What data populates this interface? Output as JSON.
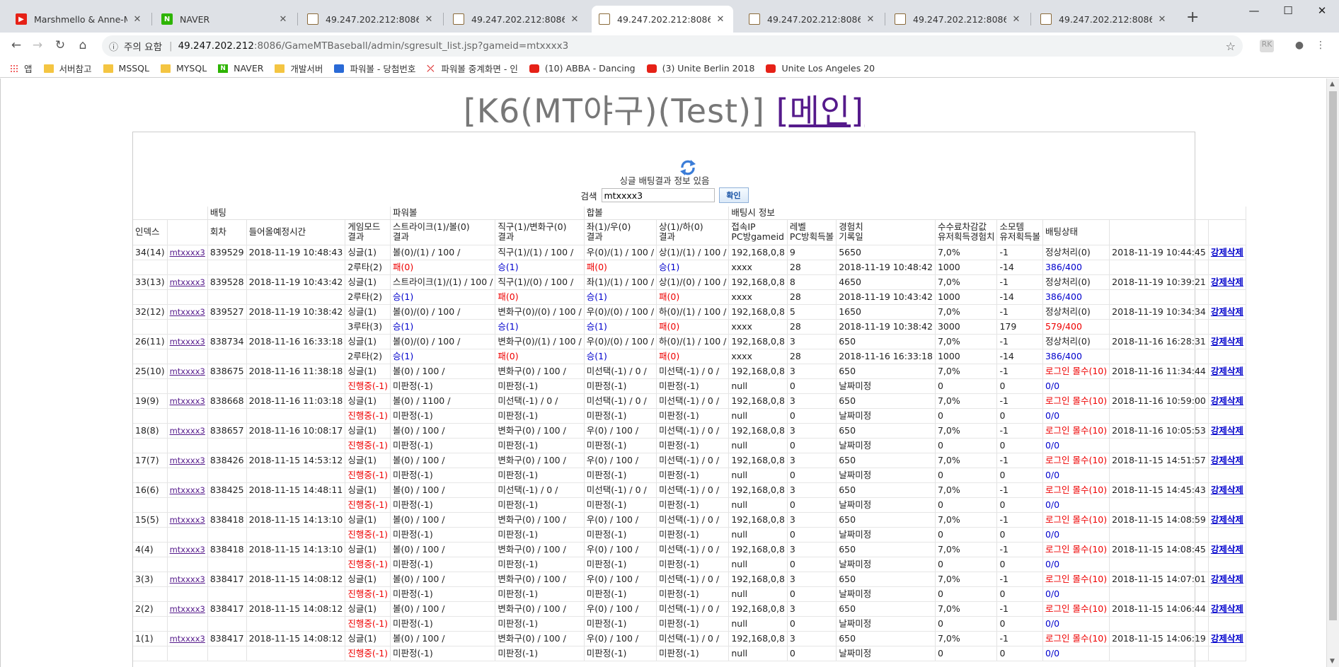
{
  "browser": {
    "tabs": [
      {
        "title": "Marshmello & Anne-Marie",
        "favicon": "youtube-icon"
      },
      {
        "title": "NAVER",
        "favicon": "naver-icon"
      },
      {
        "title": "49.247.202.212:8086/Game",
        "favicon": "page-icon"
      },
      {
        "title": "49.247.202.212:8086/Game",
        "favicon": "page-icon"
      },
      {
        "title": "49.247.202.212:8086/Gam",
        "favicon": "page-icon",
        "active": true
      },
      {
        "title": "49.247.202.212:8086/Game",
        "favicon": "page-icon"
      },
      {
        "title": "49.247.202.212:8086/Game",
        "favicon": "page-icon"
      },
      {
        "title": "49.247.202.212:8086/Game",
        "favicon": "page-icon"
      }
    ],
    "security_warning": "주의 요함",
    "url_host": "49.247.202.212",
    "url_path": ":8086/GameMTBaseball/admin/sgresult_list.jsp?gameid=mtxxxx3",
    "bookmarks": [
      {
        "label": "앱",
        "icon": "apps-grid-icon"
      },
      {
        "label": "서버참고",
        "icon": "folder-icon"
      },
      {
        "label": "MSSQL",
        "icon": "folder-icon"
      },
      {
        "label": "MYSQL",
        "icon": "folder-icon"
      },
      {
        "label": "NAVER",
        "icon": "naver-icon"
      },
      {
        "label": "개발서버",
        "icon": "folder-icon"
      },
      {
        "label": "파워볼 - 당첨번호",
        "icon": "powerball-icon"
      },
      {
        "label": "파워볼 중계화면 - 인",
        "icon": "powerball-relay-icon"
      },
      {
        "label": "(10) ABBA - Dancing",
        "icon": "youtube-icon"
      },
      {
        "label": "(3) Unite Berlin 2018",
        "icon": "youtube-icon"
      },
      {
        "label": "Unite Los Angeles 20",
        "icon": "youtube-icon"
      }
    ]
  },
  "page": {
    "title": "[K6(MT야구)(Test)]",
    "main_link": "[메인]",
    "info_text": "싱글 배팅결과 정보 있음",
    "search_label": "검색",
    "search_value": "mtxxxx3",
    "search_button": "확인"
  },
  "table": {
    "group_headers": [
      "배팅",
      "파워볼",
      "합볼",
      "배팅시 정보"
    ],
    "headers": [
      [
        "인덱스",
        ""
      ],
      [
        "",
        ""
      ],
      [
        "회차",
        ""
      ],
      [
        "들어올예정시간",
        ""
      ],
      [
        "게임모드",
        "결과"
      ],
      [
        "스트라이크(1)/볼(0)",
        "결과"
      ],
      [
        "직구(1)/변화구(0)",
        "결과"
      ],
      [
        "좌(1)/우(0)",
        "결과"
      ],
      [
        "상(1)/하(0)",
        "결과"
      ],
      [
        "접속IP",
        "PC방gameid"
      ],
      [
        "레벨",
        "PC방획득볼"
      ],
      [
        "경험치",
        "기록일"
      ],
      [
        "수수료차감값",
        "유저획득경험치"
      ],
      [
        "소모템",
        "유저획득볼"
      ],
      [
        "배팅상태",
        ""
      ],
      [
        "",
        ""
      ],
      [
        "",
        ""
      ]
    ],
    "rows": [
      {
        "idx": "34(14)",
        "user": "mtxxxx3",
        "round": "839529",
        "time": "2018-11-19 10:48:43",
        "mode": "싱글(1)",
        "c5": "볼(0)/(1) / 100 /",
        "c6": "직구(1)/(1) / 100 /",
        "c7": "우(0)/(1) / 100 /",
        "c8": "상(1)/(1) / 100 /",
        "ip": "192,168,0,8",
        "lv": "9",
        "exp": "5650",
        "fee": "7,0%",
        "item": "-1",
        "status": "정상처리(0)",
        "status_red": false,
        "date": "2018-11-19 10:44:45",
        "del": "강제삭제",
        "r_mode": "2루타(2)",
        "r_mode_red": false,
        "r5": "패(0)",
        "r5c": "red",
        "r6": "승(1)",
        "r6c": "blue",
        "r7": "패(0)",
        "r7c": "red",
        "r8": "승(1)",
        "r8c": "blue",
        "r_ip": "xxxx",
        "r_lv": "28",
        "r_exp": "2018-11-19 10:48:42",
        "r_fee": "1000",
        "r_item": "-14",
        "r_status": "386/400",
        "r_status_red": false
      },
      {
        "idx": "33(13)",
        "user": "mtxxxx3",
        "round": "839528",
        "time": "2018-11-19 10:43:42",
        "mode": "싱글(1)",
        "c5": "스트라이크(1)/(1) / 100 /",
        "c6": "직구(1)/(0) / 100 /",
        "c7": "좌(1)/(1) / 100 /",
        "c8": "상(1)/(0) / 100 /",
        "ip": "192,168,0,8",
        "lv": "8",
        "exp": "4650",
        "fee": "7,0%",
        "item": "-1",
        "status": "정상처리(0)",
        "status_red": false,
        "date": "2018-11-19 10:39:21",
        "del": "강제삭제",
        "r_mode": "2루타(2)",
        "r_mode_red": false,
        "r5": "승(1)",
        "r5c": "blue",
        "r6": "패(0)",
        "r6c": "red",
        "r7": "승(1)",
        "r7c": "blue",
        "r8": "패(0)",
        "r8c": "red",
        "r_ip": "xxxx",
        "r_lv": "28",
        "r_exp": "2018-11-19 10:43:42",
        "r_fee": "1000",
        "r_item": "-14",
        "r_status": "386/400",
        "r_status_red": false
      },
      {
        "idx": "32(12)",
        "user": "mtxxxx3",
        "round": "839527",
        "time": "2018-11-19 10:38:42",
        "mode": "싱글(1)",
        "c5": "볼(0)/(0) / 100 /",
        "c6": "변화구(0)/(0) / 100 /",
        "c7": "우(0)/(0) / 100 /",
        "c8": "하(0)/(1) / 100 /",
        "ip": "192,168,0,8",
        "lv": "5",
        "exp": "1650",
        "fee": "7,0%",
        "item": "-1",
        "status": "정상처리(0)",
        "status_red": false,
        "date": "2018-11-19 10:34:34",
        "del": "강제삭제",
        "r_mode": "3루타(3)",
        "r_mode_red": false,
        "r5": "승(1)",
        "r5c": "blue",
        "r6": "승(1)",
        "r6c": "blue",
        "r7": "승(1)",
        "r7c": "blue",
        "r8": "패(0)",
        "r8c": "red",
        "r_ip": "xxxx",
        "r_lv": "28",
        "r_exp": "2018-11-19 10:38:42",
        "r_fee": "3000",
        "r_item": "179",
        "r_status": "579/400",
        "r_status_red": true
      },
      {
        "idx": "26(11)",
        "user": "mtxxxx3",
        "round": "838734",
        "time": "2018-11-16 16:33:18",
        "mode": "싱글(1)",
        "c5": "볼(0)/(0) / 100 /",
        "c6": "변화구(0)/(1) / 100 /",
        "c7": "우(0)/(0) / 100 /",
        "c8": "하(0)/(1) / 100 /",
        "ip": "192,168,0,8",
        "lv": "3",
        "exp": "650",
        "fee": "7,0%",
        "item": "-1",
        "status": "정상처리(0)",
        "status_red": false,
        "date": "2018-11-16 16:28:31",
        "del": "강제삭제",
        "r_mode": "2루타(2)",
        "r_mode_red": false,
        "r5": "승(1)",
        "r5c": "blue",
        "r6": "패(0)",
        "r6c": "red",
        "r7": "승(1)",
        "r7c": "blue",
        "r8": "패(0)",
        "r8c": "red",
        "r_ip": "xxxx",
        "r_lv": "28",
        "r_exp": "2018-11-16 16:33:18",
        "r_fee": "1000",
        "r_item": "-14",
        "r_status": "386/400",
        "r_status_red": false
      },
      {
        "idx": "25(10)",
        "user": "mtxxxx3",
        "round": "838675",
        "time": "2018-11-16 11:38:18",
        "mode": "싱글(1)",
        "c5": "볼(0) / 100 /",
        "c6": "변화구(0) / 100 /",
        "c7": "미선택(-1) / 0 /",
        "c8": "미선택(-1) / 0 /",
        "ip": "192,168,0,8",
        "lv": "3",
        "exp": "650",
        "fee": "7,0%",
        "item": "-1",
        "status": "로그인 몰수(10)",
        "status_red": true,
        "date": "2018-11-16 11:34:44",
        "del": "강제삭제",
        "r_mode": "진행중(-1)",
        "r_mode_red": true,
        "r5": "미판정(-1)",
        "r5c": "",
        "r6": "미판정(-1)",
        "r6c": "",
        "r7": "미판정(-1)",
        "r7c": "",
        "r8": "미판정(-1)",
        "r8c": "",
        "r_ip": "null",
        "r_lv": "0",
        "r_exp": "날짜미정",
        "r_fee": "0",
        "r_item": "0",
        "r_status": "0/0",
        "r_status_red": false
      },
      {
        "idx": "19(9)",
        "user": "mtxxxx3",
        "round": "838668",
        "time": "2018-11-16 11:03:18",
        "mode": "싱글(1)",
        "c5": "볼(0) / 1100 /",
        "c6": "미선택(-1) / 0 /",
        "c7": "미선택(-1) / 0 /",
        "c8": "미선택(-1) / 0 /",
        "ip": "192,168,0,8",
        "lv": "3",
        "exp": "650",
        "fee": "7,0%",
        "item": "-1",
        "status": "로그인 몰수(10)",
        "status_red": true,
        "date": "2018-11-16 10:59:00",
        "del": "강제삭제",
        "r_mode": "진행중(-1)",
        "r_mode_red": true,
        "r5": "미판정(-1)",
        "r5c": "",
        "r6": "미판정(-1)",
        "r6c": "",
        "r7": "미판정(-1)",
        "r7c": "",
        "r8": "미판정(-1)",
        "r8c": "",
        "r_ip": "null",
        "r_lv": "0",
        "r_exp": "날짜미정",
        "r_fee": "0",
        "r_item": "0",
        "r_status": "0/0",
        "r_status_red": false
      },
      {
        "idx": "18(8)",
        "user": "mtxxxx3",
        "round": "838657",
        "time": "2018-11-16 10:08:17",
        "mode": "싱글(1)",
        "c5": "볼(0) / 100 /",
        "c6": "변화구(0) / 100 /",
        "c7": "우(0) / 100 /",
        "c8": "미선택(-1) / 0 /",
        "ip": "192,168,0,8",
        "lv": "3",
        "exp": "650",
        "fee": "7,0%",
        "item": "-1",
        "status": "로그인 몰수(10)",
        "status_red": true,
        "date": "2018-11-16 10:05:53",
        "del": "강제삭제",
        "r_mode": "진행중(-1)",
        "r_mode_red": true,
        "r5": "미판정(-1)",
        "r5c": "",
        "r6": "미판정(-1)",
        "r6c": "",
        "r7": "미판정(-1)",
        "r7c": "",
        "r8": "미판정(-1)",
        "r8c": "",
        "r_ip": "null",
        "r_lv": "0",
        "r_exp": "날짜미정",
        "r_fee": "0",
        "r_item": "0",
        "r_status": "0/0",
        "r_status_red": false
      },
      {
        "idx": "17(7)",
        "user": "mtxxxx3",
        "round": "838426",
        "time": "2018-11-15 14:53:12",
        "mode": "싱글(1)",
        "c5": "볼(0) / 100 /",
        "c6": "변화구(0) / 100 /",
        "c7": "우(0) / 100 /",
        "c8": "미선택(-1) / 0 /",
        "ip": "192,168,0,8",
        "lv": "3",
        "exp": "650",
        "fee": "7,0%",
        "item": "-1",
        "status": "로그인 몰수(10)",
        "status_red": true,
        "date": "2018-11-15 14:51:57",
        "del": "강제삭제",
        "r_mode": "진행중(-1)",
        "r_mode_red": true,
        "r5": "미판정(-1)",
        "r5c": "",
        "r6": "미판정(-1)",
        "r6c": "",
        "r7": "미판정(-1)",
        "r7c": "",
        "r8": "미판정(-1)",
        "r8c": "",
        "r_ip": "null",
        "r_lv": "0",
        "r_exp": "날짜미정",
        "r_fee": "0",
        "r_item": "0",
        "r_status": "0/0",
        "r_status_red": false
      },
      {
        "idx": "16(6)",
        "user": "mtxxxx3",
        "round": "838425",
        "time": "2018-11-15 14:48:11",
        "mode": "싱글(1)",
        "c5": "볼(0) / 100 /",
        "c6": "미선택(-1) / 0 /",
        "c7": "미선택(-1) / 0 /",
        "c8": "미선택(-1) / 0 /",
        "ip": "192,168,0,8",
        "lv": "3",
        "exp": "650",
        "fee": "7,0%",
        "item": "-1",
        "status": "로그인 몰수(10)",
        "status_red": true,
        "date": "2018-11-15 14:45:43",
        "del": "강제삭제",
        "r_mode": "진행중(-1)",
        "r_mode_red": true,
        "r5": "미판정(-1)",
        "r5c": "",
        "r6": "미판정(-1)",
        "r6c": "",
        "r7": "미판정(-1)",
        "r7c": "",
        "r8": "미판정(-1)",
        "r8c": "",
        "r_ip": "null",
        "r_lv": "0",
        "r_exp": "날짜미정",
        "r_fee": "0",
        "r_item": "0",
        "r_status": "0/0",
        "r_status_red": false
      },
      {
        "idx": "15(5)",
        "user": "mtxxxx3",
        "round": "838418",
        "time": "2018-11-15 14:13:10",
        "mode": "싱글(1)",
        "c5": "볼(0) / 100 /",
        "c6": "변화구(0) / 100 /",
        "c7": "우(0) / 100 /",
        "c8": "미선택(-1) / 0 /",
        "ip": "192,168,0,8",
        "lv": "3",
        "exp": "650",
        "fee": "7,0%",
        "item": "-1",
        "status": "로그인 몰수(10)",
        "status_red": true,
        "date": "2018-11-15 14:08:59",
        "del": "강제삭제",
        "r_mode": "진행중(-1)",
        "r_mode_red": true,
        "r5": "미판정(-1)",
        "r5c": "",
        "r6": "미판정(-1)",
        "r6c": "",
        "r7": "미판정(-1)",
        "r7c": "",
        "r8": "미판정(-1)",
        "r8c": "",
        "r_ip": "null",
        "r_lv": "0",
        "r_exp": "날짜미정",
        "r_fee": "0",
        "r_item": "0",
        "r_status": "0/0",
        "r_status_red": false
      },
      {
        "idx": "4(4)",
        "user": "mtxxxx3",
        "round": "838418",
        "time": "2018-11-15 14:13:10",
        "mode": "싱글(1)",
        "c5": "볼(0) / 100 /",
        "c6": "변화구(0) / 100 /",
        "c7": "우(0) / 100 /",
        "c8": "미선택(-1) / 0 /",
        "ip": "192,168,0,8",
        "lv": "3",
        "exp": "650",
        "fee": "7,0%",
        "item": "-1",
        "status": "로그인 몰수(10)",
        "status_red": true,
        "date": "2018-11-15 14:08:45",
        "del": "강제삭제",
        "r_mode": "진행중(-1)",
        "r_mode_red": true,
        "r5": "미판정(-1)",
        "r5c": "",
        "r6": "미판정(-1)",
        "r6c": "",
        "r7": "미판정(-1)",
        "r7c": "",
        "r8": "미판정(-1)",
        "r8c": "",
        "r_ip": "null",
        "r_lv": "0",
        "r_exp": "날짜미정",
        "r_fee": "0",
        "r_item": "0",
        "r_status": "0/0",
        "r_status_red": false
      },
      {
        "idx": "3(3)",
        "user": "mtxxxx3",
        "round": "838417",
        "time": "2018-11-15 14:08:12",
        "mode": "싱글(1)",
        "c5": "볼(0) / 100 /",
        "c6": "변화구(0) / 100 /",
        "c7": "우(0) / 100 /",
        "c8": "미선택(-1) / 0 /",
        "ip": "192,168,0,8",
        "lv": "3",
        "exp": "650",
        "fee": "7,0%",
        "item": "-1",
        "status": "로그인 몰수(10)",
        "status_red": true,
        "date": "2018-11-15 14:07:01",
        "del": "강제삭제",
        "r_mode": "진행중(-1)",
        "r_mode_red": true,
        "r5": "미판정(-1)",
        "r5c": "",
        "r6": "미판정(-1)",
        "r6c": "",
        "r7": "미판정(-1)",
        "r7c": "",
        "r8": "미판정(-1)",
        "r8c": "",
        "r_ip": "null",
        "r_lv": "0",
        "r_exp": "날짜미정",
        "r_fee": "0",
        "r_item": "0",
        "r_status": "0/0",
        "r_status_red": false
      },
      {
        "idx": "2(2)",
        "user": "mtxxxx3",
        "round": "838417",
        "time": "2018-11-15 14:08:12",
        "mode": "싱글(1)",
        "c5": "볼(0) / 100 /",
        "c6": "변화구(0) / 100 /",
        "c7": "우(0) / 100 /",
        "c8": "미선택(-1) / 0 /",
        "ip": "192,168,0,8",
        "lv": "3",
        "exp": "650",
        "fee": "7,0%",
        "item": "-1",
        "status": "로그인 몰수(10)",
        "status_red": true,
        "date": "2018-11-15 14:06:44",
        "del": "강제삭제",
        "r_mode": "진행중(-1)",
        "r_mode_red": true,
        "r5": "미판정(-1)",
        "r5c": "",
        "r6": "미판정(-1)",
        "r6c": "",
        "r7": "미판정(-1)",
        "r7c": "",
        "r8": "미판정(-1)",
        "r8c": "",
        "r_ip": "null",
        "r_lv": "0",
        "r_exp": "날짜미정",
        "r_fee": "0",
        "r_item": "0",
        "r_status": "0/0",
        "r_status_red": false
      },
      {
        "idx": "1(1)",
        "user": "mtxxxx3",
        "round": "838417",
        "time": "2018-11-15 14:08:12",
        "mode": "싱글(1)",
        "c5": "볼(0) / 100 /",
        "c6": "변화구(0) / 100 /",
        "c7": "우(0) / 100 /",
        "c8": "미선택(-1) / 0 /",
        "ip": "192,168,0,8",
        "lv": "3",
        "exp": "650",
        "fee": "7,0%",
        "item": "-1",
        "status": "로그인 몰수(10)",
        "status_red": true,
        "date": "2018-11-15 14:06:19",
        "del": "강제삭제",
        "r_mode": "진행중(-1)",
        "r_mode_red": true,
        "r5": "미판정(-1)",
        "r5c": "",
        "r6": "미판정(-1)",
        "r6c": "",
        "r7": "미판정(-1)",
        "r7c": "",
        "r8": "미판정(-1)",
        "r8c": "",
        "r_ip": "null",
        "r_lv": "0",
        "r_exp": "날짜미정",
        "r_fee": "0",
        "r_item": "0",
        "r_status": "0/0",
        "r_status_red": false
      }
    ]
  },
  "colors": {
    "result_red": "#e00000",
    "result_blue": "#0000cc",
    "link_purple": "#551a8b"
  }
}
